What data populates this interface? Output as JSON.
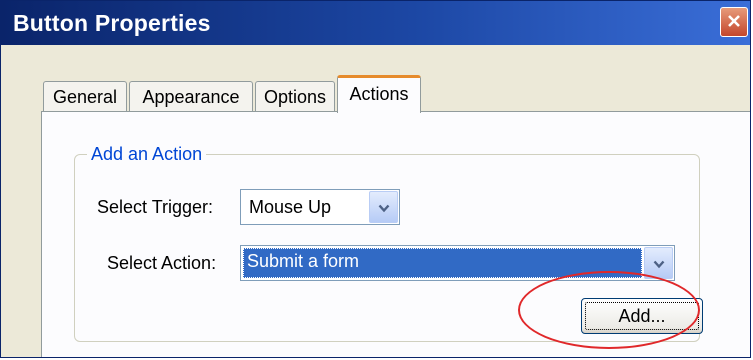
{
  "window": {
    "title": "Button Properties"
  },
  "tabs": [
    {
      "label": "General",
      "active": false
    },
    {
      "label": "Appearance",
      "active": false
    },
    {
      "label": "Options",
      "active": false
    },
    {
      "label": "Actions",
      "active": true
    }
  ],
  "actions_panel": {
    "group_title": "Add an Action",
    "trigger": {
      "label": "Select Trigger:",
      "value": "Mouse Up"
    },
    "action": {
      "label": "Select Action:",
      "value": "Submit a form"
    },
    "add_button_label": "Add..."
  },
  "icons": {
    "close": "close-icon",
    "dropdown": "chevron-down-icon"
  },
  "colors": {
    "titlebar": "#0a246a",
    "selection": "#316ac5",
    "highlight_ring": "#e0282a",
    "active_tab_accent": "#e68b2c",
    "group_title": "#0046d5"
  }
}
